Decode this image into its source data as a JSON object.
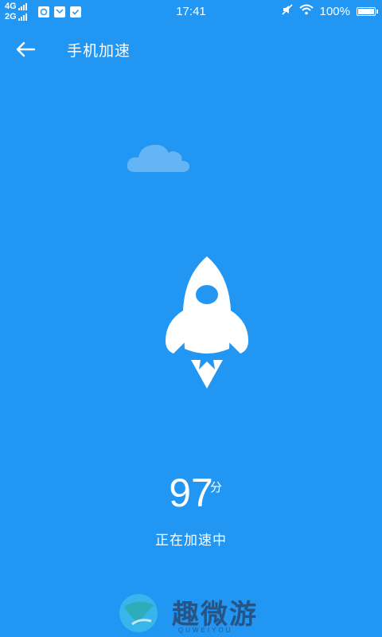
{
  "status_bar": {
    "network_1": "4G",
    "network_2": "2G",
    "time": "17:41",
    "battery": "100%",
    "battery_level": 1.0
  },
  "header": {
    "title": "手机加速",
    "back_icon": "arrow-left-icon"
  },
  "main": {
    "score": "97",
    "score_unit": "分",
    "status_text": "正在加速中"
  },
  "watermark": {
    "brand": "趣微游",
    "sub": "QUWEIYOU"
  },
  "colors": {
    "background": "#2196F3",
    "cloud": "#64B5F6",
    "foreground": "#FFFFFF"
  }
}
